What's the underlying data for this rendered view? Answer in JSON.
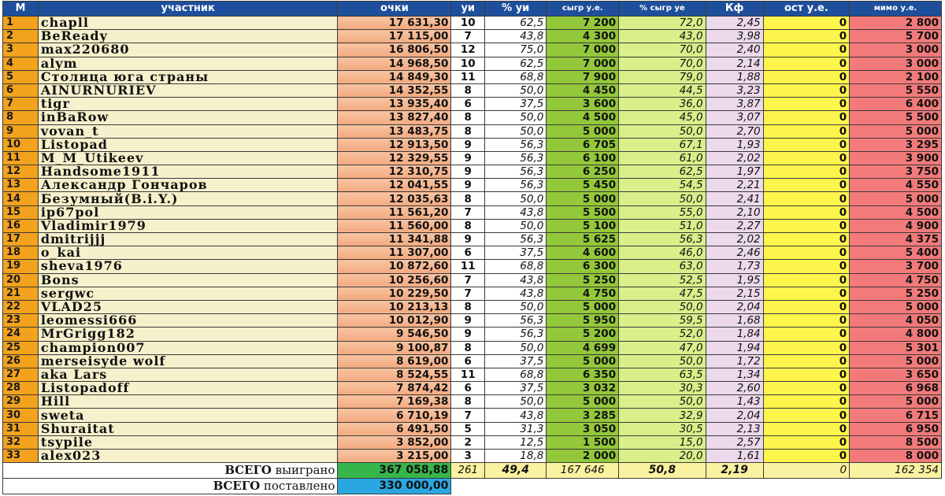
{
  "headers": {
    "m": "М",
    "name": "участник",
    "points": "очки",
    "ui": "уи",
    "pct_ui": "% уи",
    "won": "сыгр у.е.",
    "pct_won": "% сыгр уе",
    "kf": "Кф",
    "rest": "ост у.е.",
    "missed": "мимо у.е."
  },
  "rows": [
    {
      "m": "1",
      "name": "chapll",
      "points": "17 631,30",
      "ui": "10",
      "pct_ui": "62,5",
      "won": "7 200",
      "pct_won": "72,0",
      "kf": "2,45",
      "rest": "0",
      "missed": "2 800"
    },
    {
      "m": "2",
      "name": "BeReady",
      "points": "17 115,00",
      "ui": "7",
      "pct_ui": "43,8",
      "won": "4 300",
      "pct_won": "43,0",
      "kf": "3,98",
      "rest": "0",
      "missed": "5 700"
    },
    {
      "m": "3",
      "name": "max220680",
      "points": "16 806,50",
      "ui": "12",
      "pct_ui": "75,0",
      "won": "7 000",
      "pct_won": "70,0",
      "kf": "2,40",
      "rest": "0",
      "missed": "3 000"
    },
    {
      "m": "4",
      "name": "alym",
      "points": "14 968,50",
      "ui": "10",
      "pct_ui": "62,5",
      "won": "7 000",
      "pct_won": "70,0",
      "kf": "2,14",
      "rest": "0",
      "missed": "3 000"
    },
    {
      "m": "5",
      "name": "Столица юга страны",
      "points": "14 849,30",
      "ui": "11",
      "pct_ui": "68,8",
      "won": "7 900",
      "pct_won": "79,0",
      "kf": "1,88",
      "rest": "0",
      "missed": "2 100"
    },
    {
      "m": "6",
      "name": "AINURNURIEV",
      "points": "14 352,55",
      "ui": "8",
      "pct_ui": "50,0",
      "won": "4 450",
      "pct_won": "44,5",
      "kf": "3,23",
      "rest": "0",
      "missed": "5 550"
    },
    {
      "m": "7",
      "name": "tigr",
      "points": "13 935,40",
      "ui": "6",
      "pct_ui": "37,5",
      "won": "3 600",
      "pct_won": "36,0",
      "kf": "3,87",
      "rest": "0",
      "missed": "6 400"
    },
    {
      "m": "8",
      "name": "inBaRow",
      "points": "13 827,40",
      "ui": "8",
      "pct_ui": "50,0",
      "won": "4 500",
      "pct_won": "45,0",
      "kf": "3,07",
      "rest": "0",
      "missed": "5 500"
    },
    {
      "m": "9",
      "name": "vovan_t",
      "points": "13 483,75",
      "ui": "8",
      "pct_ui": "50,0",
      "won": "5 000",
      "pct_won": "50,0",
      "kf": "2,70",
      "rest": "0",
      "missed": "5 000"
    },
    {
      "m": "10",
      "name": "Listopad",
      "points": "12 913,50",
      "ui": "9",
      "pct_ui": "56,3",
      "won": "6 705",
      "pct_won": "67,1",
      "kf": "1,93",
      "rest": "0",
      "missed": "3 295"
    },
    {
      "m": "11",
      "name": "M_M_Utikeev",
      "points": "12 329,55",
      "ui": "9",
      "pct_ui": "56,3",
      "won": "6 100",
      "pct_won": "61,0",
      "kf": "2,02",
      "rest": "0",
      "missed": "3 900"
    },
    {
      "m": "12",
      "name": "Handsome1911",
      "points": "12 310,75",
      "ui": "9",
      "pct_ui": "56,3",
      "won": "6 250",
      "pct_won": "62,5",
      "kf": "1,97",
      "rest": "0",
      "missed": "3 750"
    },
    {
      "m": "13",
      "name": "Александр Гончаров",
      "points": "12 041,55",
      "ui": "9",
      "pct_ui": "56,3",
      "won": "5 450",
      "pct_won": "54,5",
      "kf": "2,21",
      "rest": "0",
      "missed": "4 550"
    },
    {
      "m": "14",
      "name": "Безумный(B.i.Y.)",
      "points": "12 035,63",
      "ui": "8",
      "pct_ui": "50,0",
      "won": "5 000",
      "pct_won": "50,0",
      "kf": "2,41",
      "rest": "0",
      "missed": "5 000"
    },
    {
      "m": "15",
      "name": "ip67pol",
      "points": "11 561,20",
      "ui": "7",
      "pct_ui": "43,8",
      "won": "5 500",
      "pct_won": "55,0",
      "kf": "2,10",
      "rest": "0",
      "missed": "4 500"
    },
    {
      "m": "16",
      "name": "Vladimir1979",
      "points": "11 560,00",
      "ui": "8",
      "pct_ui": "50,0",
      "won": "5 100",
      "pct_won": "51,0",
      "kf": "2,27",
      "rest": "0",
      "missed": "4 900"
    },
    {
      "m": "17",
      "name": "dmitrijjj",
      "points": "11 341,88",
      "ui": "9",
      "pct_ui": "56,3",
      "won": "5 625",
      "pct_won": "56,3",
      "kf": "2,02",
      "rest": "0",
      "missed": "4 375"
    },
    {
      "m": "18",
      "name": "o_kai",
      "points": "11 307,00",
      "ui": "6",
      "pct_ui": "37,5",
      "won": "4 600",
      "pct_won": "46,0",
      "kf": "2,46",
      "rest": "0",
      "missed": "5 400"
    },
    {
      "m": "19",
      "name": "sheva1976",
      "points": "10 872,60",
      "ui": "11",
      "pct_ui": "68,8",
      "won": "6 300",
      "pct_won": "63,0",
      "kf": "1,73",
      "rest": "0",
      "missed": "3 700"
    },
    {
      "m": "20",
      "name": "Bons",
      "points": "10 256,60",
      "ui": "7",
      "pct_ui": "43,8",
      "won": "5 250",
      "pct_won": "52,5",
      "kf": "1,95",
      "rest": "0",
      "missed": "4 750"
    },
    {
      "m": "21",
      "name": "sergwc",
      "points": "10 229,50",
      "ui": "7",
      "pct_ui": "43,8",
      "won": "4 750",
      "pct_won": "47,5",
      "kf": "2,15",
      "rest": "0",
      "missed": "5 250"
    },
    {
      "m": "22",
      "name": "VLAD25",
      "points": "10 213,13",
      "ui": "8",
      "pct_ui": "50,0",
      "won": "5 000",
      "pct_won": "50,0",
      "kf": "2,04",
      "rest": "0",
      "missed": "5 000"
    },
    {
      "m": "23",
      "name": "leomessi666",
      "points": "10 012,90",
      "ui": "9",
      "pct_ui": "56,3",
      "won": "5 950",
      "pct_won": "59,5",
      "kf": "1,68",
      "rest": "0",
      "missed": "4 050"
    },
    {
      "m": "24",
      "name": "MrGrigg182",
      "points": "9 546,50",
      "ui": "9",
      "pct_ui": "56,3",
      "won": "5 200",
      "pct_won": "52,0",
      "kf": "1,84",
      "rest": "0",
      "missed": "4 800"
    },
    {
      "m": "25",
      "name": "champion007",
      "points": "9 100,87",
      "ui": "8",
      "pct_ui": "50,0",
      "won": "4 699",
      "pct_won": "47,0",
      "kf": "1,94",
      "rest": "0",
      "missed": "5 301"
    },
    {
      "m": "26",
      "name": "merseisyde wolf",
      "points": "8 619,00",
      "ui": "6",
      "pct_ui": "37,5",
      "won": "5 000",
      "pct_won": "50,0",
      "kf": "1,72",
      "rest": "0",
      "missed": "5 000"
    },
    {
      "m": "27",
      "name": "aka Lars",
      "points": "8 524,55",
      "ui": "11",
      "pct_ui": "68,8",
      "won": "6 350",
      "pct_won": "63,5",
      "kf": "1,34",
      "rest": "0",
      "missed": "3 650"
    },
    {
      "m": "28",
      "name": "Listopadoff",
      "points": "7 874,42",
      "ui": "6",
      "pct_ui": "37,5",
      "won": "3 032",
      "pct_won": "30,3",
      "kf": "2,60",
      "rest": "0",
      "missed": "6 968"
    },
    {
      "m": "29",
      "name": "Hill",
      "points": "7 169,38",
      "ui": "8",
      "pct_ui": "50,0",
      "won": "5 000",
      "pct_won": "50,0",
      "kf": "1,43",
      "rest": "0",
      "missed": "5 000"
    },
    {
      "m": "30",
      "name": "sweta",
      "points": "6 710,19",
      "ui": "7",
      "pct_ui": "43,8",
      "won": "3 285",
      "pct_won": "32,9",
      "kf": "2,04",
      "rest": "0",
      "missed": "6 715"
    },
    {
      "m": "31",
      "name": "Shuraitat",
      "points": "6 491,50",
      "ui": "5",
      "pct_ui": "31,3",
      "won": "3 050",
      "pct_won": "30,5",
      "kf": "2,13",
      "rest": "0",
      "missed": "6 950"
    },
    {
      "m": "32",
      "name": "tsypile",
      "points": "3 852,00",
      "ui": "2",
      "pct_ui": "12,5",
      "won": "1 500",
      "pct_won": "15,0",
      "kf": "2,57",
      "rest": "0",
      "missed": "8 500"
    },
    {
      "m": "33",
      "name": "alex023",
      "points": "3 215,00",
      "ui": "3",
      "pct_ui": "18,8",
      "won": "2 000",
      "pct_won": "20,0",
      "kf": "1,61",
      "rest": "0",
      "missed": "8 000"
    }
  ],
  "totals": {
    "won_label_bold": "ВСЕГО",
    "won_label_rest": " выиграно",
    "points": "367 058,88",
    "ui": "261",
    "pct_ui": "49,4",
    "won": "167 646",
    "pct_won": "50,8",
    "kf": "2,19",
    "rest": "0",
    "missed": "162 354",
    "staked_label_bold": "ВСЕГО",
    "staked_label_rest": " поставлено",
    "staked": "330 000,00"
  }
}
